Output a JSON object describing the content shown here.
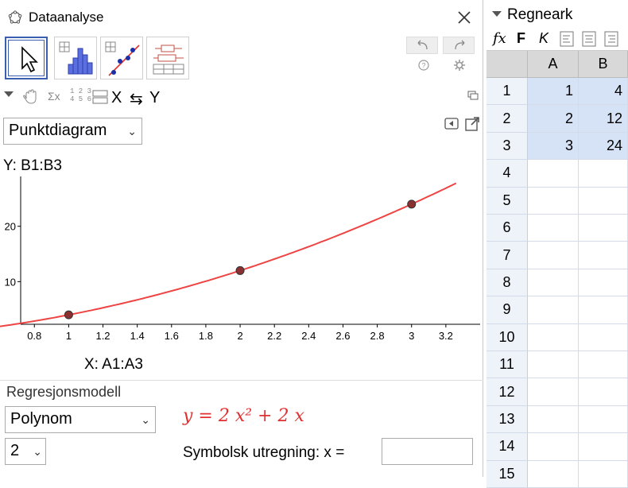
{
  "window": {
    "title": "Dataanalyse",
    "close_icon": "close-icon"
  },
  "toolbar": {
    "tools": [
      "cursor-tool",
      "one-variable-analysis-tool",
      "two-variable-regression-tool",
      "multi-variable-analysis-tool"
    ],
    "undo_icon": "undo-icon",
    "redo_icon": "redo-icon",
    "help_icon": "help-icon",
    "settings_icon": "gear-icon"
  },
  "sub_toolbar": {
    "x_label": "X",
    "swap_symbol": "⇆",
    "y_label": "Y",
    "stats_label": "Σx",
    "data_numbers_top": "1 2 3",
    "data_numbers_bottom": "4 5 6"
  },
  "plot": {
    "type_select": "Punktdiagram",
    "y_source": "Y:  B1:B3",
    "x_source": "X:  A1:A3"
  },
  "chart_data": {
    "type": "scatter",
    "x": [
      1,
      2,
      3
    ],
    "y": [
      4,
      12,
      24
    ],
    "xticks": [
      "0.8",
      "1",
      "1.2",
      "1.4",
      "1.6",
      "1.8",
      "2",
      "2.2",
      "2.4",
      "2.6",
      "2.8",
      "3",
      "3.2"
    ],
    "yticks": [
      "10",
      "20"
    ],
    "xlim": [
      0.72,
      3.4
    ],
    "ylim": [
      2.3,
      29
    ],
    "fit": "2x^2+2x",
    "point_color": "#8b3030",
    "fit_color": "#ee4444"
  },
  "regression": {
    "title": "Regresjonsmodell",
    "model": "Polynom",
    "degree": "2",
    "formula": "y = 2 x² + 2 x",
    "symbolic_label": "Symbolsk utregning:  x =",
    "symbolic_value": ""
  },
  "spreadsheet": {
    "title": "Regneark",
    "tool_fx": "fx",
    "tool_bold": "F",
    "tool_italic": "K",
    "columns": [
      "A",
      "B"
    ],
    "rows": [
      "1",
      "2",
      "3",
      "4",
      "5",
      "6",
      "7",
      "8",
      "9",
      "10",
      "11",
      "12",
      "13",
      "14",
      "15"
    ],
    "cells": [
      {
        "a": "1",
        "b": "4"
      },
      {
        "a": "2",
        "b": "12"
      },
      {
        "a": "3",
        "b": "24"
      }
    ]
  }
}
